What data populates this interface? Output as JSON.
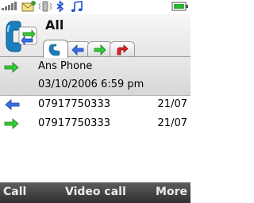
{
  "status_bar": {
    "icons": [
      "signal-strength-icon",
      "new-message-icon",
      "vibrate-icon",
      "bluetooth-icon",
      "music-note-icon",
      "battery-icon"
    ]
  },
  "header": {
    "title": "All",
    "app_icon": "call-log-icon",
    "tabs": [
      {
        "icon": "all-calls-tab-icon",
        "active": true
      },
      {
        "icon": "missed-calls-arrow-icon",
        "active": false
      },
      {
        "icon": "dialed-calls-arrow-icon",
        "active": false
      },
      {
        "icon": "received-calls-arrow-icon",
        "active": false
      }
    ]
  },
  "call_list": {
    "selected": {
      "icon": "dialed-call-icon",
      "name": "Ans Phone",
      "datetime": "03/10/2006 6:59 pm"
    },
    "items": [
      {
        "icon": "received-call-icon",
        "number": "07917750333",
        "date": "21/07"
      },
      {
        "icon": "dialed-call-icon",
        "number": "07917750333",
        "date": "21/07"
      }
    ]
  },
  "softkeys": {
    "left": "Call",
    "middle": "Video call",
    "right": "More"
  },
  "colors": {
    "dialed_arrow": "#33cc33",
    "received_arrow": "#3366ee",
    "missed_arrow": "#dd2222",
    "softkey_bar": "#3a3a3a"
  }
}
